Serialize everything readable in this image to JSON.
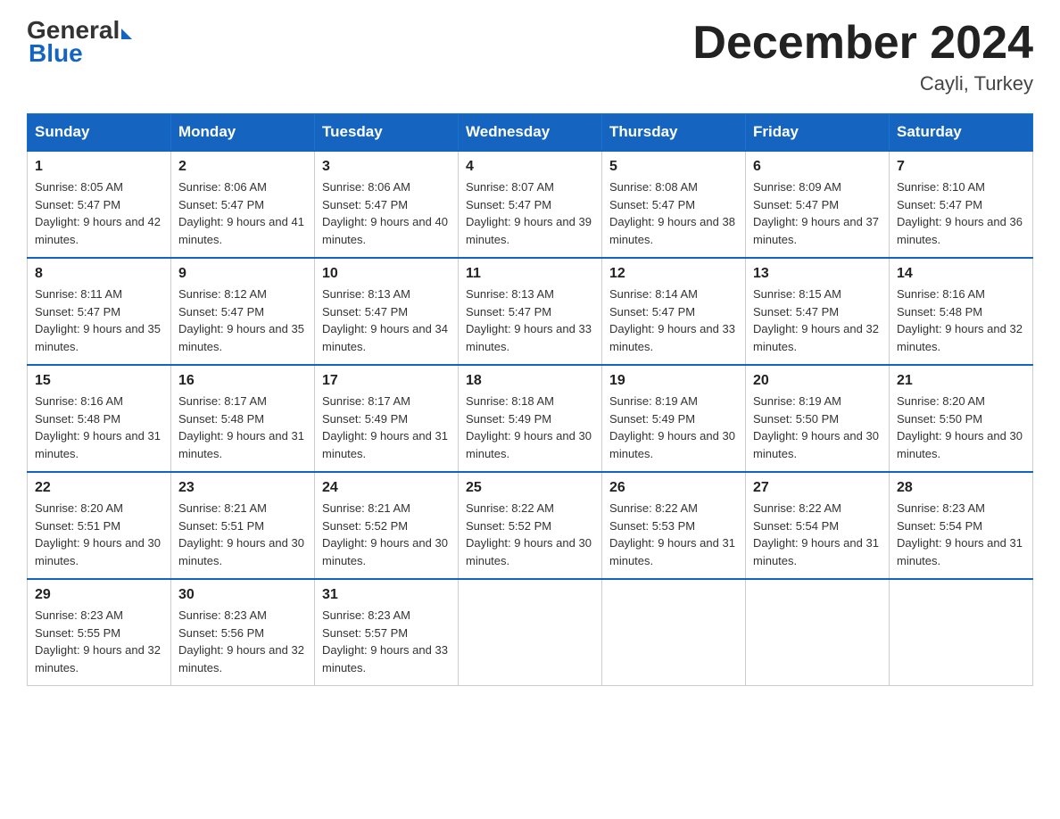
{
  "logo": {
    "general": "General",
    "blue": "Blue",
    "line2": "Blue"
  },
  "header": {
    "title": "December 2024",
    "location": "Cayli, Turkey"
  },
  "days_of_week": [
    "Sunday",
    "Monday",
    "Tuesday",
    "Wednesday",
    "Thursday",
    "Friday",
    "Saturday"
  ],
  "weeks": [
    [
      {
        "day": "1",
        "sunrise": "Sunrise: 8:05 AM",
        "sunset": "Sunset: 5:47 PM",
        "daylight": "Daylight: 9 hours and 42 minutes."
      },
      {
        "day": "2",
        "sunrise": "Sunrise: 8:06 AM",
        "sunset": "Sunset: 5:47 PM",
        "daylight": "Daylight: 9 hours and 41 minutes."
      },
      {
        "day": "3",
        "sunrise": "Sunrise: 8:06 AM",
        "sunset": "Sunset: 5:47 PM",
        "daylight": "Daylight: 9 hours and 40 minutes."
      },
      {
        "day": "4",
        "sunrise": "Sunrise: 8:07 AM",
        "sunset": "Sunset: 5:47 PM",
        "daylight": "Daylight: 9 hours and 39 minutes."
      },
      {
        "day": "5",
        "sunrise": "Sunrise: 8:08 AM",
        "sunset": "Sunset: 5:47 PM",
        "daylight": "Daylight: 9 hours and 38 minutes."
      },
      {
        "day": "6",
        "sunrise": "Sunrise: 8:09 AM",
        "sunset": "Sunset: 5:47 PM",
        "daylight": "Daylight: 9 hours and 37 minutes."
      },
      {
        "day": "7",
        "sunrise": "Sunrise: 8:10 AM",
        "sunset": "Sunset: 5:47 PM",
        "daylight": "Daylight: 9 hours and 36 minutes."
      }
    ],
    [
      {
        "day": "8",
        "sunrise": "Sunrise: 8:11 AM",
        "sunset": "Sunset: 5:47 PM",
        "daylight": "Daylight: 9 hours and 35 minutes."
      },
      {
        "day": "9",
        "sunrise": "Sunrise: 8:12 AM",
        "sunset": "Sunset: 5:47 PM",
        "daylight": "Daylight: 9 hours and 35 minutes."
      },
      {
        "day": "10",
        "sunrise": "Sunrise: 8:13 AM",
        "sunset": "Sunset: 5:47 PM",
        "daylight": "Daylight: 9 hours and 34 minutes."
      },
      {
        "day": "11",
        "sunrise": "Sunrise: 8:13 AM",
        "sunset": "Sunset: 5:47 PM",
        "daylight": "Daylight: 9 hours and 33 minutes."
      },
      {
        "day": "12",
        "sunrise": "Sunrise: 8:14 AM",
        "sunset": "Sunset: 5:47 PM",
        "daylight": "Daylight: 9 hours and 33 minutes."
      },
      {
        "day": "13",
        "sunrise": "Sunrise: 8:15 AM",
        "sunset": "Sunset: 5:47 PM",
        "daylight": "Daylight: 9 hours and 32 minutes."
      },
      {
        "day": "14",
        "sunrise": "Sunrise: 8:16 AM",
        "sunset": "Sunset: 5:48 PM",
        "daylight": "Daylight: 9 hours and 32 minutes."
      }
    ],
    [
      {
        "day": "15",
        "sunrise": "Sunrise: 8:16 AM",
        "sunset": "Sunset: 5:48 PM",
        "daylight": "Daylight: 9 hours and 31 minutes."
      },
      {
        "day": "16",
        "sunrise": "Sunrise: 8:17 AM",
        "sunset": "Sunset: 5:48 PM",
        "daylight": "Daylight: 9 hours and 31 minutes."
      },
      {
        "day": "17",
        "sunrise": "Sunrise: 8:17 AM",
        "sunset": "Sunset: 5:49 PM",
        "daylight": "Daylight: 9 hours and 31 minutes."
      },
      {
        "day": "18",
        "sunrise": "Sunrise: 8:18 AM",
        "sunset": "Sunset: 5:49 PM",
        "daylight": "Daylight: 9 hours and 30 minutes."
      },
      {
        "day": "19",
        "sunrise": "Sunrise: 8:19 AM",
        "sunset": "Sunset: 5:49 PM",
        "daylight": "Daylight: 9 hours and 30 minutes."
      },
      {
        "day": "20",
        "sunrise": "Sunrise: 8:19 AM",
        "sunset": "Sunset: 5:50 PM",
        "daylight": "Daylight: 9 hours and 30 minutes."
      },
      {
        "day": "21",
        "sunrise": "Sunrise: 8:20 AM",
        "sunset": "Sunset: 5:50 PM",
        "daylight": "Daylight: 9 hours and 30 minutes."
      }
    ],
    [
      {
        "day": "22",
        "sunrise": "Sunrise: 8:20 AM",
        "sunset": "Sunset: 5:51 PM",
        "daylight": "Daylight: 9 hours and 30 minutes."
      },
      {
        "day": "23",
        "sunrise": "Sunrise: 8:21 AM",
        "sunset": "Sunset: 5:51 PM",
        "daylight": "Daylight: 9 hours and 30 minutes."
      },
      {
        "day": "24",
        "sunrise": "Sunrise: 8:21 AM",
        "sunset": "Sunset: 5:52 PM",
        "daylight": "Daylight: 9 hours and 30 minutes."
      },
      {
        "day": "25",
        "sunrise": "Sunrise: 8:22 AM",
        "sunset": "Sunset: 5:52 PM",
        "daylight": "Daylight: 9 hours and 30 minutes."
      },
      {
        "day": "26",
        "sunrise": "Sunrise: 8:22 AM",
        "sunset": "Sunset: 5:53 PM",
        "daylight": "Daylight: 9 hours and 31 minutes."
      },
      {
        "day": "27",
        "sunrise": "Sunrise: 8:22 AM",
        "sunset": "Sunset: 5:54 PM",
        "daylight": "Daylight: 9 hours and 31 minutes."
      },
      {
        "day": "28",
        "sunrise": "Sunrise: 8:23 AM",
        "sunset": "Sunset: 5:54 PM",
        "daylight": "Daylight: 9 hours and 31 minutes."
      }
    ],
    [
      {
        "day": "29",
        "sunrise": "Sunrise: 8:23 AM",
        "sunset": "Sunset: 5:55 PM",
        "daylight": "Daylight: 9 hours and 32 minutes."
      },
      {
        "day": "30",
        "sunrise": "Sunrise: 8:23 AM",
        "sunset": "Sunset: 5:56 PM",
        "daylight": "Daylight: 9 hours and 32 minutes."
      },
      {
        "day": "31",
        "sunrise": "Sunrise: 8:23 AM",
        "sunset": "Sunset: 5:57 PM",
        "daylight": "Daylight: 9 hours and 33 minutes."
      },
      null,
      null,
      null,
      null
    ]
  ]
}
